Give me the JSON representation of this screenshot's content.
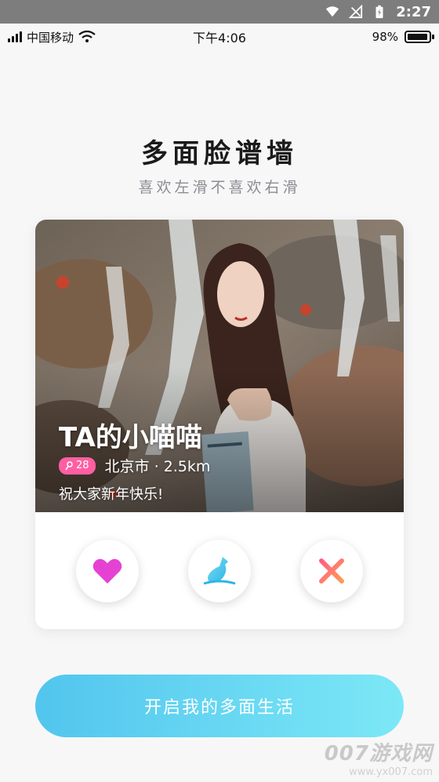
{
  "system_bar": {
    "time": "2:27"
  },
  "status_bar": {
    "carrier": "中国移动",
    "time": "下午4:06",
    "battery": "98%",
    "battery_level": 0.98
  },
  "header": {
    "title": "多面脸谱墙",
    "subtitle": "喜欢左滑不喜欢右滑"
  },
  "profile": {
    "name": "TA的小喵喵",
    "age": "28",
    "location": "北京市 · 2.5km",
    "bio": "祝大家新年快乐!"
  },
  "actions": [
    {
      "icon": "heart-icon",
      "color": "#e542d4"
    },
    {
      "icon": "bottle-icon",
      "color": "#29b6e6"
    },
    {
      "icon": "close-icon",
      "color": "#ff6b6b"
    }
  ],
  "cta": {
    "label": "开启我的多面生活",
    "color_start": "#52c5ee",
    "color_end": "#7ce8f6"
  },
  "watermark": {
    "brand": "007游戏网",
    "url": "www.yx007.com"
  }
}
